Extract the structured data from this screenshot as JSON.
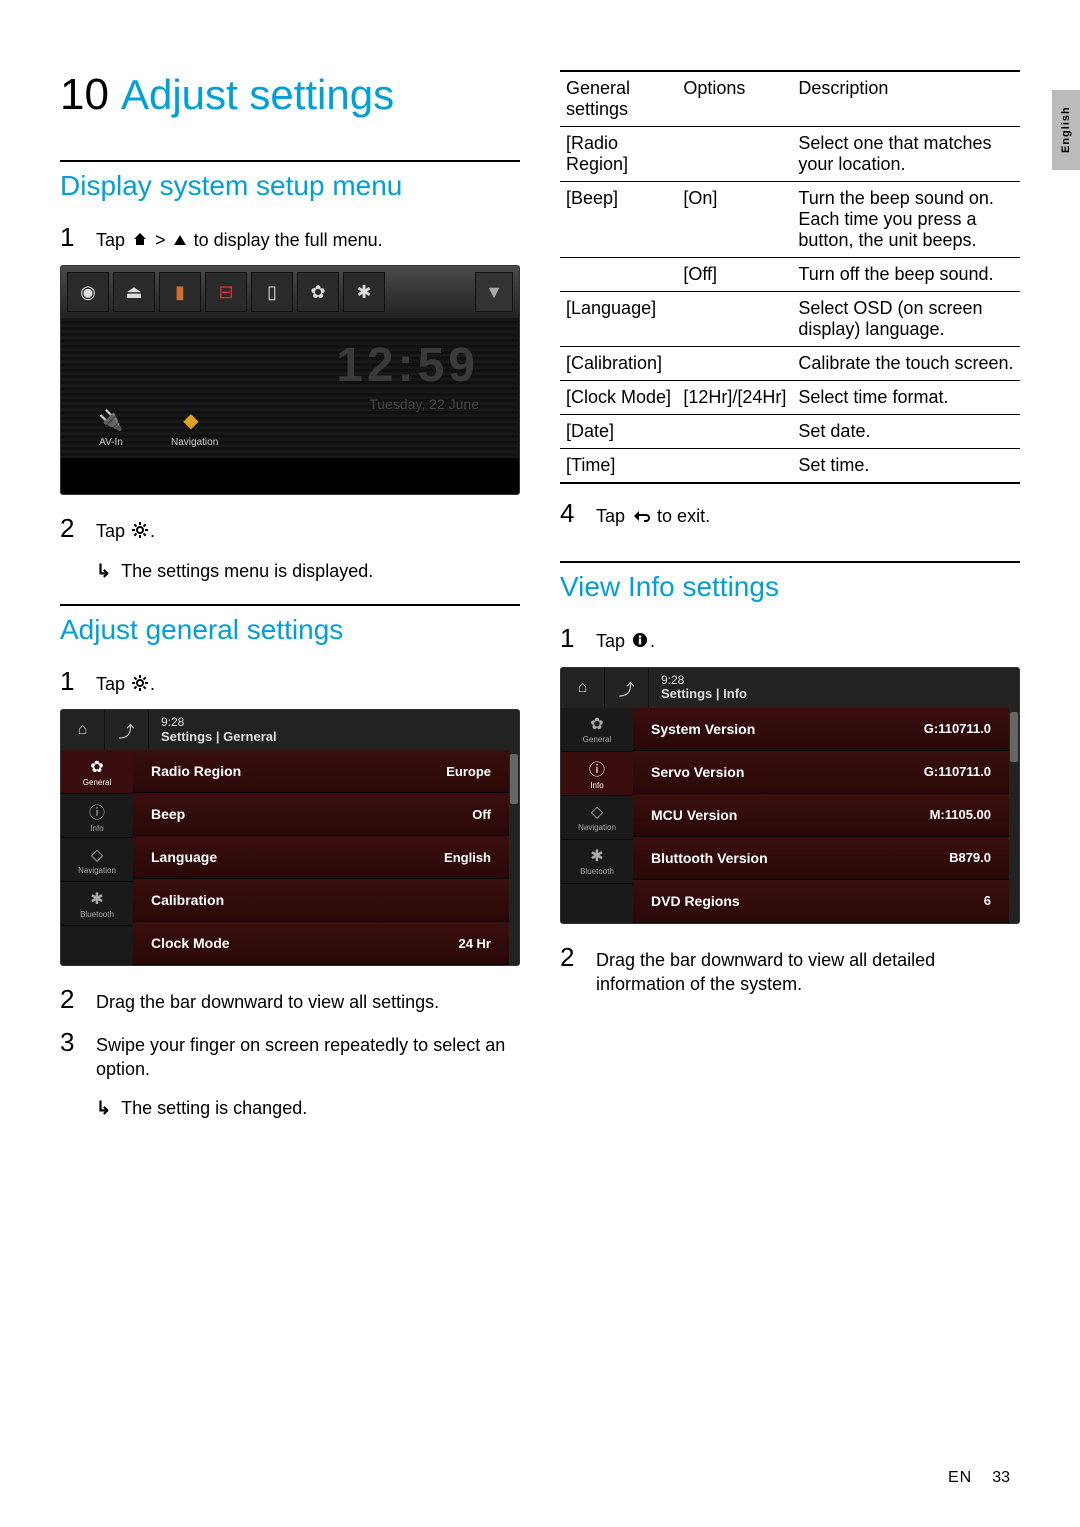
{
  "chapter": {
    "number": "10",
    "title": "Adjust settings"
  },
  "lang_tab": "English",
  "footer": {
    "lang": "EN",
    "page": "33"
  },
  "sections": {
    "display_menu": {
      "title": "Display system setup menu",
      "step1_pre": "Tap ",
      "step1_mid": " > ",
      "step1_post": " to display the full menu.",
      "step2": "Tap ",
      "step2_end": ".",
      "step2_arrow": "The settings menu is displayed."
    },
    "general": {
      "title": "Adjust general settings",
      "step1": "Tap ",
      "step1_end": ".",
      "step2": "Drag the bar downward to view all settings.",
      "step3": "Swipe your finger on screen repeatedly to select an option.",
      "step3_arrow": "The setting is changed.",
      "step4": "Tap ",
      "step4_end": " to exit."
    },
    "info": {
      "title": "View Info settings",
      "step1": "Tap ",
      "step1_end": ".",
      "step2": "Drag the bar downward to view all detailed information of the system."
    }
  },
  "shot_home": {
    "clock": "12:59",
    "date": "Tuesday, 22 June",
    "avin": "AV-In",
    "nav": "Navigation"
  },
  "shot_general": {
    "time": "9:28",
    "crumb": "Settings | Gerneral",
    "tabs": [
      "General",
      "Info",
      "Navigation",
      "Bluetooth"
    ],
    "active_tab": 0,
    "rows": [
      {
        "label": "Radio Region",
        "value": "Europe"
      },
      {
        "label": "Beep",
        "value": "Off"
      },
      {
        "label": "Language",
        "value": "English"
      },
      {
        "label": "Calibration",
        "value": ""
      },
      {
        "label": "Clock Mode",
        "value": "24 Hr"
      }
    ]
  },
  "shot_info": {
    "time": "9:28",
    "crumb": "Settings | Info",
    "tabs": [
      "General",
      "Info",
      "Navigation",
      "Bluetooth"
    ],
    "active_tab": 1,
    "rows": [
      {
        "label": "System Version",
        "value": "G:110711.0"
      },
      {
        "label": "Servo Version",
        "value": "G:110711.0"
      },
      {
        "label": "MCU Version",
        "value": "M:1105.00"
      },
      {
        "label": "Bluttooth Version",
        "value": "B879.0"
      },
      {
        "label": "DVD Regions",
        "value": "6"
      }
    ]
  },
  "table": {
    "headers": [
      "General settings",
      "Options",
      "Description"
    ],
    "rows": [
      {
        "setting": "[Radio Region]",
        "option": "",
        "desc": "Select one that matches your location."
      },
      {
        "setting": "[Beep]",
        "option": "[On]",
        "desc": "Turn the beep sound on. Each time you press a button, the unit beeps."
      },
      {
        "setting": "",
        "option": "[Off]",
        "desc": "Turn off the beep sound."
      },
      {
        "setting": "[Language]",
        "option": "",
        "desc": "Select OSD (on screen display) language."
      },
      {
        "setting": "[Calibration]",
        "option": "",
        "desc": "Calibrate the touch screen."
      },
      {
        "setting": "[Clock Mode]",
        "option": "[12Hr]/[24Hr]",
        "desc": "Select time format."
      },
      {
        "setting": "[Date]",
        "option": "",
        "desc": "Set date."
      },
      {
        "setting": "[Time]",
        "option": "",
        "desc": "Set time."
      }
    ]
  }
}
